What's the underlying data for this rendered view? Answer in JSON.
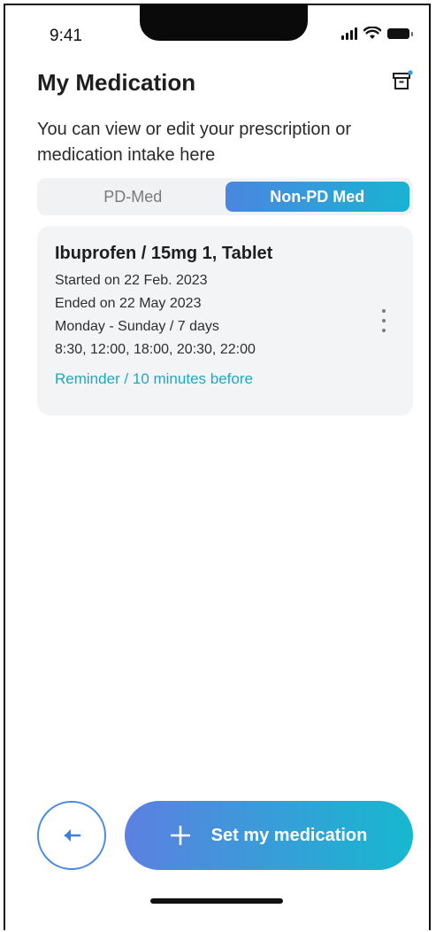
{
  "status_bar": {
    "time": "9:41",
    "icons": [
      "signal-icon",
      "wifi-icon",
      "battery-icon"
    ]
  },
  "header": {
    "title": "My Medication",
    "action_icon": "archive-icon",
    "subtitle": "You can view or edit your prescription or medication intake here"
  },
  "tabs": [
    {
      "label": "PD-Med",
      "active": false
    },
    {
      "label": "Non-PD Med",
      "active": true
    }
  ],
  "medication": {
    "name": "Ibuprofen / 15mg 1, Tablet",
    "started": "Started on 22 Feb. 2023",
    "ended": "Ended on 22 May 2023",
    "schedule": "Monday - Sunday / 7 days",
    "times": "8:30, 12:00, 18:00, 20:30, 22:00",
    "reminder": "Reminder / 10 minutes before",
    "menu_icon": "more-vertical-icon"
  },
  "actions": {
    "back_icon": "arrow-left-icon",
    "primary_label": "Set my medication",
    "primary_icon": "plus-icon"
  },
  "colors": {
    "accent_start": "#4b86e0",
    "accent_end": "#19b3d2",
    "reminder_text": "#1ea8c6",
    "card_bg": "#f3f4f6"
  }
}
